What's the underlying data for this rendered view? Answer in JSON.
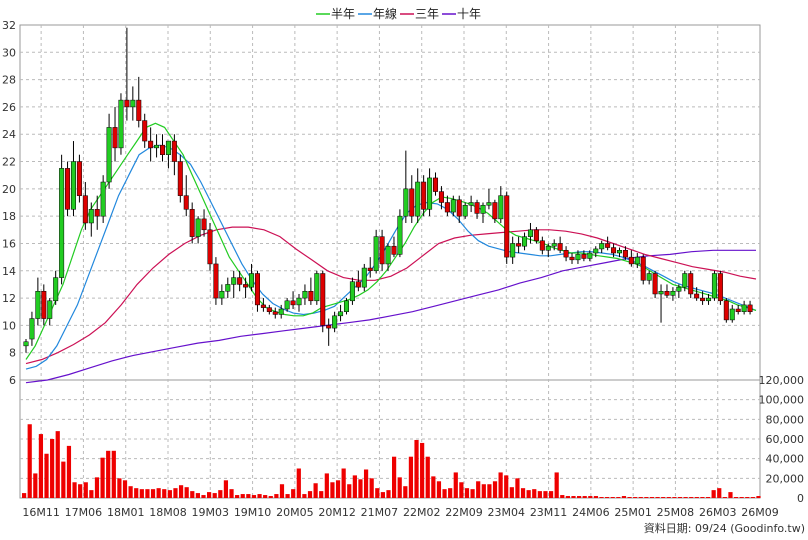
{
  "chart_data": {
    "type": "candlestick",
    "legend": [
      {
        "label": "半年",
        "color": "#22cc22"
      },
      {
        "label": "年線",
        "color": "#2288dd"
      },
      {
        "label": "三年",
        "color": "#cc1155"
      },
      {
        "label": "十年",
        "color": "#6611cc"
      }
    ],
    "price_axis": {
      "ticks": [
        6,
        8,
        10,
        12,
        14,
        16,
        18,
        20,
        22,
        24,
        26,
        28,
        30,
        32
      ],
      "ylim": [
        6,
        32
      ]
    },
    "volume_axis": {
      "ticks": [
        "0",
        "20,000",
        "40,000",
        "60,000",
        "80,000",
        "100,000",
        "120,000"
      ],
      "ylim": [
        0,
        120000
      ]
    },
    "x_labels": [
      "16M11",
      "17M06",
      "18M01",
      "18M08",
      "19M03",
      "19M10",
      "20M05",
      "20M12",
      "21M07",
      "22M02",
      "22M09",
      "23M04",
      "23M11",
      "24M06",
      "25M01",
      "25M08",
      "26M03",
      "26M09"
    ],
    "footer": "資料日期: 09/24  (Goodinfo.tw)",
    "up_color": "#22cc22",
    "down_color": "#dd0000",
    "volume_color": "#ee0000",
    "candles": [
      [
        8.5,
        9,
        8,
        8.8
      ],
      [
        9,
        11,
        8.5,
        10.5
      ],
      [
        10.5,
        13.5,
        10,
        12.5
      ],
      [
        12.5,
        13,
        10,
        10.5
      ],
      [
        10.5,
        12,
        10,
        11.8
      ],
      [
        11.8,
        14,
        11.5,
        13.5
      ],
      [
        13.5,
        22.5,
        13,
        21.5
      ],
      [
        21.5,
        22,
        18,
        18.5
      ],
      [
        18.5,
        23.5,
        18,
        22
      ],
      [
        22,
        22.5,
        19,
        19.5
      ],
      [
        19.5,
        20.5,
        17,
        17.5
      ],
      [
        17.5,
        19,
        16.5,
        18.5
      ],
      [
        18.5,
        19.5,
        17,
        18
      ],
      [
        18,
        21,
        17.5,
        20.5
      ],
      [
        20.5,
        25.5,
        20,
        24.5
      ],
      [
        24.5,
        26,
        22,
        23
      ],
      [
        23,
        27,
        22.5,
        26.5
      ],
      [
        26.5,
        31.8,
        25,
        26
      ],
      [
        26,
        27.5,
        25,
        26.5
      ],
      [
        26.5,
        28.2,
        24.5,
        25
      ],
      [
        25,
        25.5,
        23,
        23.5
      ],
      [
        23.5,
        24.5,
        22,
        23
      ],
      [
        23,
        24,
        22.3,
        23.2
      ],
      [
        23.2,
        24,
        22,
        22.5
      ],
      [
        22.5,
        23.5,
        21.5,
        23.5
      ],
      [
        23.5,
        24,
        21,
        22
      ],
      [
        22,
        22.5,
        19,
        19.5
      ],
      [
        19.5,
        21,
        18,
        18.5
      ],
      [
        18.5,
        19,
        16,
        16.5
      ],
      [
        16.5,
        18,
        16,
        17.8
      ],
      [
        17.8,
        18.5,
        16.5,
        17
      ],
      [
        17,
        17.5,
        14,
        14.5
      ],
      [
        14.5,
        15,
        11.5,
        12
      ],
      [
        12,
        13,
        11.5,
        12.5
      ],
      [
        12.5,
        13.5,
        12,
        13
      ],
      [
        13,
        14,
        12,
        13.5
      ],
      [
        13.5,
        14,
        12.5,
        13
      ],
      [
        13,
        13.5,
        12,
        12.8
      ],
      [
        12.8,
        14.5,
        12.5,
        13.8
      ],
      [
        13.8,
        14,
        11,
        11.5
      ],
      [
        11.5,
        12,
        11,
        11.3
      ],
      [
        11.3,
        11.5,
        10.8,
        11
      ],
      [
        11,
        11.3,
        10.5,
        10.8
      ],
      [
        10.8,
        11.5,
        10.5,
        11.2
      ],
      [
        11.2,
        12,
        11,
        11.8
      ],
      [
        11.8,
        12.5,
        11.2,
        11.5
      ],
      [
        11.5,
        12.3,
        11,
        12
      ],
      [
        12,
        13,
        11.5,
        12.5
      ],
      [
        12.5,
        13.5,
        11.5,
        11.8
      ],
      [
        11.8,
        14,
        11.5,
        13.8
      ],
      [
        13.8,
        14,
        9.5,
        10
      ],
      [
        10,
        10.5,
        8.5,
        9.8
      ],
      [
        9.8,
        11,
        9.5,
        10.7
      ],
      [
        10.7,
        11.5,
        10.3,
        11
      ],
      [
        11,
        12,
        10.8,
        11.8
      ],
      [
        11.8,
        13.5,
        11.5,
        13.2
      ],
      [
        13.2,
        14,
        12.5,
        12.8
      ],
      [
        12.8,
        14.5,
        12.5,
        14.2
      ],
      [
        14.2,
        15,
        13.5,
        14
      ],
      [
        14,
        17,
        13.8,
        16.5
      ],
      [
        16.5,
        17,
        14,
        14.5
      ],
      [
        14.5,
        16,
        14,
        15.8
      ],
      [
        15.8,
        16.5,
        15,
        15.2
      ],
      [
        15.2,
        18.5,
        15,
        18
      ],
      [
        18,
        22.8,
        17.5,
        20
      ],
      [
        20,
        21,
        17.5,
        18
      ],
      [
        18,
        21.5,
        17.5,
        20.5
      ],
      [
        20.5,
        21,
        18,
        18.5
      ],
      [
        18.5,
        21.5,
        18,
        20.8
      ],
      [
        20.8,
        21.2,
        19.5,
        19.8
      ],
      [
        19.8,
        20.2,
        18.5,
        19
      ],
      [
        19,
        19.5,
        18,
        18.3
      ],
      [
        18.3,
        19.5,
        18,
        19.2
      ],
      [
        19.2,
        19.5,
        17.5,
        18
      ],
      [
        18,
        19,
        17.8,
        18.8
      ],
      [
        18.8,
        19.5,
        18.3,
        19
      ],
      [
        19,
        19.2,
        17.8,
        18.2
      ],
      [
        18.2,
        19,
        17.5,
        18.8
      ],
      [
        18.8,
        20,
        18.5,
        19
      ],
      [
        19,
        19.2,
        17.5,
        17.8
      ],
      [
        17.8,
        20.2,
        17.5,
        19.5
      ],
      [
        19.5,
        19.8,
        14.5,
        15
      ],
      [
        15,
        16.5,
        14.5,
        16
      ],
      [
        16,
        16.5,
        15.3,
        15.8
      ],
      [
        15.8,
        16.8,
        15.5,
        16.5
      ],
      [
        16.5,
        17.5,
        16,
        17
      ],
      [
        17,
        17.2,
        16,
        16.2
      ],
      [
        16.2,
        16.5,
        15.2,
        15.5
      ],
      [
        15.5,
        16,
        15,
        15.8
      ],
      [
        15.8,
        16.3,
        15.5,
        16
      ],
      [
        16,
        16.5,
        15.3,
        15.5
      ],
      [
        15.5,
        15.8,
        14.7,
        15
      ],
      [
        15,
        15.3,
        14.5,
        14.8
      ],
      [
        14.8,
        15.5,
        14.5,
        15.2
      ],
      [
        15.2,
        15.5,
        14.7,
        14.9
      ],
      [
        14.9,
        15.5,
        14.7,
        15.3
      ],
      [
        15.3,
        15.8,
        15,
        15.6
      ],
      [
        15.6,
        16.2,
        15.3,
        16
      ],
      [
        16,
        16.5,
        15.5,
        15.7
      ],
      [
        15.7,
        16,
        15,
        15.3
      ],
      [
        15.3,
        15.7,
        15,
        15.5
      ],
      [
        15.5,
        15.8,
        14.8,
        15
      ],
      [
        15,
        15.5,
        14.3,
        14.5
      ],
      [
        14.5,
        15.3,
        14.2,
        15
      ],
      [
        15,
        15.2,
        13,
        13.3
      ],
      [
        13.3,
        14,
        13,
        13.8
      ],
      [
        13.8,
        14,
        12,
        12.3
      ],
      [
        12.3,
        13,
        10.2,
        12.5
      ],
      [
        12.5,
        13,
        12,
        12.2
      ],
      [
        12.2,
        12.8,
        11.8,
        12.5
      ],
      [
        12.5,
        13,
        12,
        12.8
      ],
      [
        12.8,
        14,
        12.5,
        13.8
      ],
      [
        13.8,
        14,
        12,
        12.3
      ],
      [
        12.3,
        12.8,
        11.8,
        12
      ],
      [
        12,
        12.5,
        11.5,
        11.8
      ],
      [
        11.8,
        12.3,
        11.5,
        12
      ],
      [
        12,
        14,
        11.8,
        13.8
      ],
      [
        13.8,
        14,
        11.5,
        11.8
      ],
      [
        11.8,
        12,
        10.2,
        10.4
      ],
      [
        10.4,
        11.5,
        10.2,
        11.2
      ],
      [
        11.2,
        11.5,
        10.8,
        11
      ],
      [
        11,
        11.8,
        10.8,
        11.5
      ],
      [
        11.5,
        11.8,
        10.8,
        11
      ]
    ],
    "ma_half_year": [
      7.5,
      8.5,
      10,
      11.5,
      13,
      15,
      17,
      18.5,
      19.5,
      20.5,
      21.5,
      22.5,
      23.5,
      24.5,
      24.8,
      24.5,
      23.5,
      22.5,
      21,
      19.5,
      18,
      16.5,
      15,
      14,
      13,
      12,
      11.3,
      11,
      10.8,
      10.7,
      10.7,
      10.9,
      11.3,
      11.5,
      11.7,
      11.9,
      12.2,
      12.6,
      13.2,
      14,
      15,
      16,
      17.2,
      18.2,
      19,
      19.4,
      19.3,
      19.1,
      18.9,
      18.6,
      18.2,
      17.6,
      17,
      16.6,
      16.4,
      16.2,
      16,
      15.7,
      15.5,
      15.3,
      15.3,
      15.2,
      15.1,
      15,
      14.9,
      14.7,
      14.5,
      14.2,
      13.8,
      13.4,
      13,
      12.8,
      12.6,
      12.4,
      12.2,
      12,
      11.8,
      11.5,
      11.3,
      11.1
    ],
    "ma_year": [
      6.8,
      7,
      7.5,
      8.5,
      10,
      11.5,
      13.5,
      15.5,
      17.5,
      19.5,
      21,
      22.5,
      23,
      23.2,
      23,
      22.5,
      21.8,
      20.5,
      19,
      17.5,
      16,
      14.5,
      13.3,
      12.3,
      11.6,
      11.2,
      10.9,
      10.8,
      10.9,
      11.1,
      11.4,
      12.1,
      12.8,
      13.5,
      14.5,
      15.7,
      17,
      18.2,
      18.8,
      19,
      18.9,
      18.5,
      17.8,
      16.9,
      16.2,
      15.8,
      15.6,
      15.4,
      15.3,
      15.2,
      15.1,
      15.1,
      15.2,
      15.3,
      15.4,
      15.4,
      15.3,
      15.2,
      15,
      14.7,
      14.4,
      14,
      13.6,
      13.2,
      12.9,
      12.7,
      12.5,
      12.3,
      12,
      11.7,
      11.4,
      11.1
    ],
    "ma_three_year": [
      7.2,
      7.5,
      8,
      8.6,
      9.3,
      10.2,
      11.5,
      13,
      14.2,
      15.2,
      16,
      16.6,
      17,
      17.2,
      17.2,
      17,
      16.5,
      15.6,
      14.8,
      14,
      13.5,
      13.3,
      13.3,
      13.6,
      14.2,
      15.1,
      16,
      16.4,
      16.6,
      16.7,
      16.8,
      16.9,
      17,
      17,
      16.9,
      16.7,
      16.4,
      16,
      15.6,
      15.2,
      14.9,
      14.6,
      14.3,
      14.1,
      13.9,
      13.6,
      13.4
    ],
    "ma_ten_year": [
      5.8,
      6,
      6.4,
      6.9,
      7.4,
      7.8,
      8.1,
      8.4,
      8.7,
      8.9,
      9.2,
      9.4,
      9.6,
      9.8,
      10,
      10.2,
      10.4,
      10.7,
      11,
      11.4,
      11.8,
      12.2,
      12.6,
      13.1,
      13.5,
      14,
      14.3,
      14.6,
      14.9,
      15.1,
      15.2,
      15.4,
      15.5,
      15.5,
      15.5
    ],
    "volume": [
      5000,
      75000,
      25000,
      65000,
      45000,
      60000,
      68000,
      37000,
      53000,
      16000,
      14000,
      16000,
      8000,
      21000,
      41000,
      48000,
      48000,
      20000,
      18000,
      12000,
      10000,
      9000,
      9000,
      9000,
      10000,
      9000,
      8000,
      10000,
      13000,
      11000,
      7000,
      5000,
      3000,
      6000,
      5000,
      8000,
      18000,
      9000,
      3000,
      4000,
      4000,
      3000,
      4000,
      3000,
      2000,
      4000,
      14000,
      4000,
      9000,
      30000,
      4000,
      7000,
      15000,
      7000,
      25000,
      16000,
      18000,
      30000,
      14000,
      23000,
      19000,
      29000,
      20000,
      10000,
      6000,
      8000,
      42000,
      21000,
      12000,
      42000,
      59000,
      56000,
      42000,
      22000,
      17000,
      9000,
      10000,
      26000,
      16000,
      10000,
      9000,
      17000,
      14000,
      14000,
      17000,
      26000,
      23000,
      11000,
      20000,
      10000,
      8000,
      9000,
      7000,
      7000,
      7000,
      26000,
      3000,
      2000,
      2000,
      2000,
      2000,
      2000,
      2000,
      1000,
      1000,
      1000,
      1000,
      2000,
      1000,
      1000,
      1000,
      1000,
      1000,
      1000,
      1000,
      1000,
      1000,
      1000,
      1000,
      1000,
      1000,
      1000,
      1000,
      8000,
      10000,
      1000,
      6000,
      1000,
      1000,
      1000,
      1000,
      2000
    ]
  }
}
